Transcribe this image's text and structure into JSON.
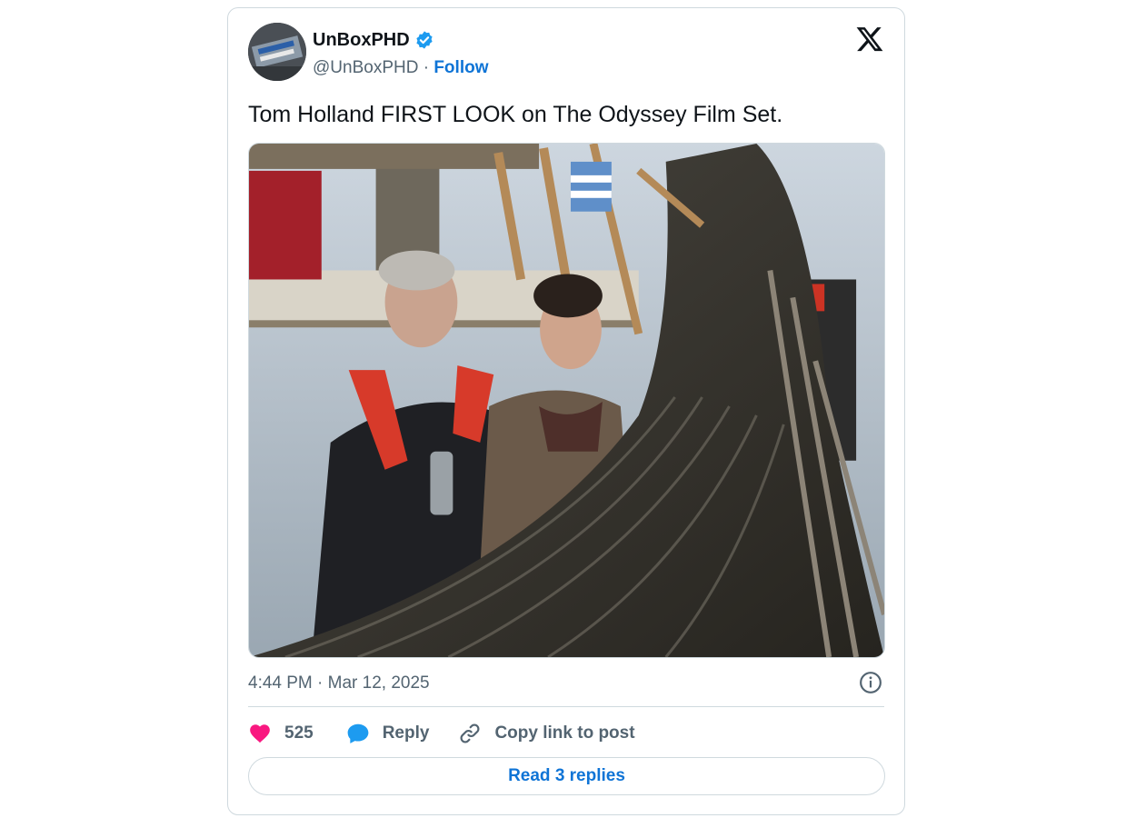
{
  "author": {
    "name": "UnBoxPHD",
    "handle": "@UnBoxPHD",
    "separator": " · ",
    "follow_label": "Follow",
    "verified": true
  },
  "tweet": {
    "text": "Tom Holland FIRST LOOK on The Odyssey Film Set.",
    "timestamp": "4:44 PM · Mar 12, 2025"
  },
  "actions": {
    "likes_count": "525",
    "reply_label": "Reply",
    "copy_link_label": "Copy link to post"
  },
  "read_replies_label": "Read 3 replies",
  "colors": {
    "like": "#f91880",
    "reply": "#1d9bf0",
    "link": "#0f74d6",
    "verified": "#1d9bf0"
  },
  "icons": [
    "verified-badge-icon",
    "x-logo-icon",
    "info-icon",
    "heart-icon",
    "reply-bubble-icon",
    "link-icon"
  ]
}
